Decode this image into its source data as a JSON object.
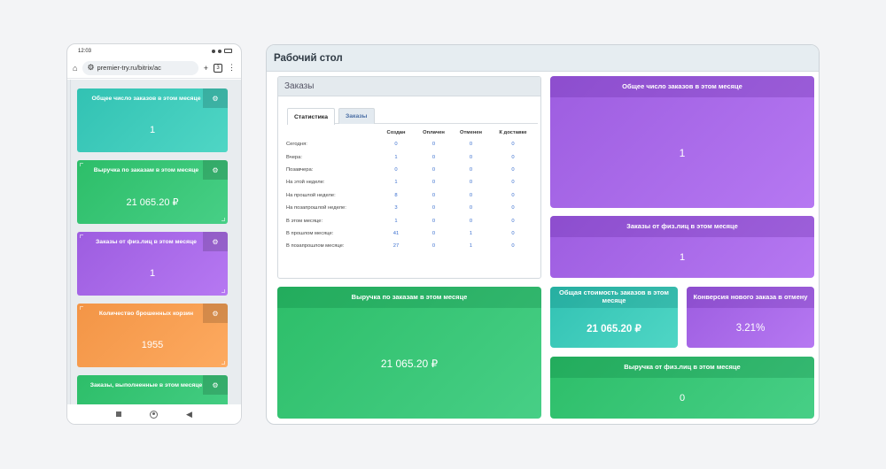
{
  "phone": {
    "time": "12:03",
    "battery": "50",
    "url": "premier-try.ru/bitrix/ac",
    "tab_count": "3",
    "tiles": [
      {
        "title": "Общее число заказов в этом месяце",
        "value": "1",
        "color": "teal"
      },
      {
        "title": "Выручка по заказам в этом месяце",
        "value": "21 065.20 ₽",
        "color": "green"
      },
      {
        "title": "Заказы от физ.лиц в этом месяце",
        "value": "1",
        "color": "purple"
      },
      {
        "title": "Количество брошенных корзин",
        "value": "1955",
        "color": "orange"
      },
      {
        "title": "Заказы, выполненные в этом месяце",
        "value": "",
        "color": "green"
      }
    ]
  },
  "desktop": {
    "title": "Рабочий стол",
    "orders_panel": {
      "title": "Заказы",
      "tabs": [
        "Статистика",
        "Заказы"
      ],
      "columns": [
        "Создан",
        "Оплачен",
        "Отменен",
        "К доставке"
      ],
      "rows": [
        {
          "label": "Сегодня:",
          "values": [
            "0",
            "0",
            "0",
            "0"
          ]
        },
        {
          "label": "Вчера:",
          "values": [
            "1",
            "0",
            "0",
            "0"
          ]
        },
        {
          "label": "Позавчера:",
          "values": [
            "0",
            "0",
            "0",
            "0"
          ]
        },
        {
          "label": "На этой неделе:",
          "values": [
            "1",
            "0",
            "0",
            "0"
          ]
        },
        {
          "label": "На прошлой неделе:",
          "values": [
            "8",
            "0",
            "0",
            "0"
          ]
        },
        {
          "label": "На позапрошлой неделе:",
          "values": [
            "3",
            "0",
            "0",
            "0"
          ]
        },
        {
          "label": "В этом месяце:",
          "values": [
            "1",
            "0",
            "0",
            "0"
          ]
        },
        {
          "label": "В прошлом месяце:",
          "values": [
            "41",
            "0",
            "1",
            "0"
          ]
        },
        {
          "label": "В позапрошлом месяце:",
          "values": [
            "27",
            "0",
            "1",
            "0"
          ]
        }
      ]
    },
    "tiles": {
      "total_orders": {
        "title": "Общее число заказов в этом месяце",
        "value": "1"
      },
      "individual_orders": {
        "title": "Заказы от физ.лиц в этом месяце",
        "value": "1"
      },
      "revenue": {
        "title": "Выручка по заказам в этом месяце",
        "value": "21 065.20 ₽"
      },
      "total_cost": {
        "title": "Общая стоимость заказов в этом месяце",
        "value": "21 065.20 ₽"
      },
      "conversion": {
        "title": "Конверсия нового заказа в отмену",
        "value": "3.21%"
      },
      "individual_revenue": {
        "title": "Выручка от физ.лиц в этом месяце",
        "value": "0"
      }
    }
  },
  "colors": {
    "purple": "#a96be9",
    "green": "#3ac577",
    "teal": "#3fccbb",
    "orange": "#f89f53",
    "link_blue": "#3a6fcf"
  }
}
